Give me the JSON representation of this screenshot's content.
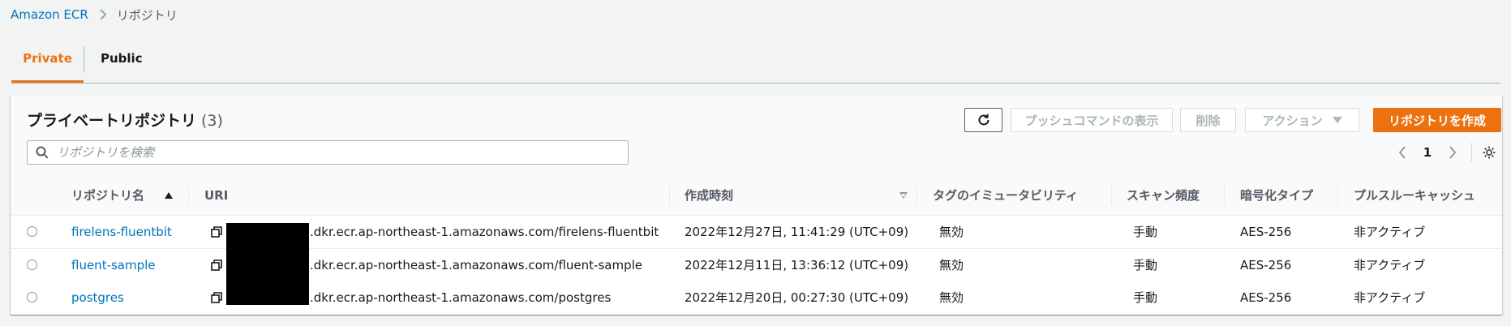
{
  "breadcrumb": {
    "root": "Amazon ECR",
    "current": "リポジトリ"
  },
  "tabs": [
    {
      "label": "Private",
      "active": true
    },
    {
      "label": "Public",
      "active": false
    }
  ],
  "panel": {
    "title": "プライベートリポジトリ",
    "count": "(3)",
    "buttons": {
      "push": "プッシュコマンドの表示",
      "delete": "削除",
      "action": "アクション",
      "create": "リポジトリを作成"
    },
    "search_placeholder": "リポジトリを検索",
    "page": "1"
  },
  "columns": [
    "リポジトリ名",
    "URI",
    "作成時刻",
    "タグのイミュータビリティ",
    "スキャン頻度",
    "暗号化タイプ",
    "プルスルーキャッシュ"
  ],
  "rows": [
    {
      "name": "firelens-fluentbit",
      "uri": ".dkr.ecr.ap-northeast-1.amazonaws.com/firelens-fluentbit",
      "created": "2022年12月27日, 11:41:29 (UTC+09)",
      "immutability": "無効",
      "scan": "手動",
      "encryption": "AES-256",
      "pull_through": "非アクティブ"
    },
    {
      "name": "fluent-sample",
      "uri": ".dkr.ecr.ap-northeast-1.amazonaws.com/fluent-sample",
      "created": "2022年12月11日, 13:36:12 (UTC+09)",
      "immutability": "無効",
      "scan": "手動",
      "encryption": "AES-256",
      "pull_through": "非アクティブ"
    },
    {
      "name": "postgres",
      "uri": ".dkr.ecr.ap-northeast-1.amazonaws.com/postgres",
      "created": "2022年12月20日, 00:27:30 (UTC+09)",
      "immutability": "無効",
      "scan": "手動",
      "encryption": "AES-256",
      "pull_through": "非アクティブ"
    }
  ],
  "colors": {
    "accent": "#ec7211",
    "link": "#0073bb"
  },
  "icons": [
    "chevron-right-icon",
    "refresh-icon",
    "caret-down-icon",
    "search-icon",
    "chevron-left-icon",
    "gear-icon",
    "copy-icon"
  ]
}
